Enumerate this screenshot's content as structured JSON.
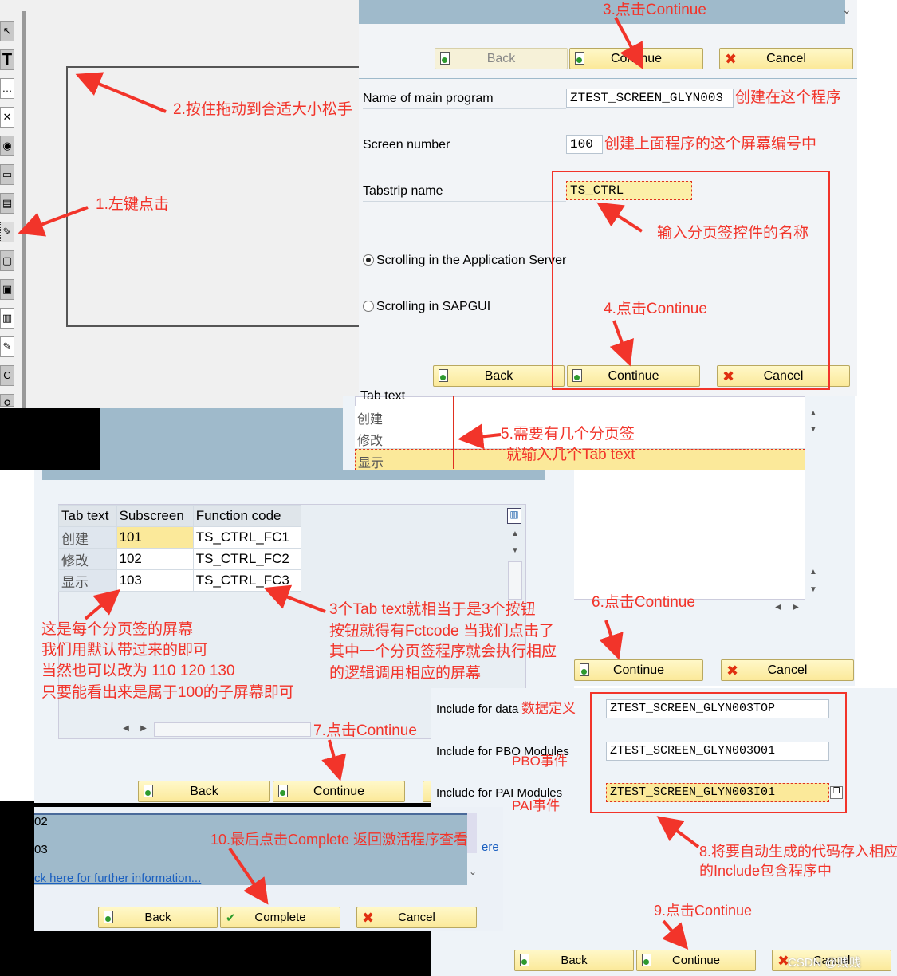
{
  "screen_painter": {
    "toolbar_icons": [
      "pointer-icon",
      "text-field-icon",
      "input-field-icon",
      "checkbox-icon",
      "radio-button-icon",
      "pushbutton-icon",
      "tabstrip-icon",
      "tabstrip-wizard-icon",
      "box-icon",
      "subscreen-icon",
      "table-control-icon",
      "table-wizard-icon",
      "custom-control-icon",
      "status-icon-icon"
    ]
  },
  "tabstrip_dialog": {
    "buttons_top": {
      "back": "Back",
      "continue": "Continue",
      "cancel": "Cancel"
    },
    "fields": [
      {
        "label": "Name of main program",
        "value": "ZTEST_SCREEN_GLYN003"
      },
      {
        "label": "Screen number",
        "value": "100"
      },
      {
        "label": "Tabstrip name",
        "value": "TS_CTRL"
      }
    ],
    "radios": [
      {
        "label": "Scrolling in the Application Server",
        "selected": true
      },
      {
        "label": "Scrolling in SAPGUI",
        "selected": false
      }
    ],
    "buttons_bottom": {
      "back": "Back",
      "continue": "Continue",
      "cancel": "Cancel"
    }
  },
  "tabtext_dialog": {
    "header": "Tab text",
    "rows": [
      "创建",
      "修改",
      "显示"
    ],
    "buttons": {
      "continue": "Continue",
      "cancel": "Cancel"
    }
  },
  "subscreen_dialog": {
    "columns": [
      "Tab text",
      "Subscreen",
      "Function code"
    ],
    "rows": [
      [
        "创建",
        "101",
        "TS_CTRL_FC1"
      ],
      [
        "修改",
        "102",
        "TS_CTRL_FC2"
      ],
      [
        "显示",
        "103",
        "TS_CTRL_FC3"
      ]
    ],
    "buttons": {
      "back": "Back",
      "continue": "Continue"
    }
  },
  "include_dialog": {
    "fields": [
      {
        "label": "Include for data",
        "value": "ZTEST_SCREEN_GLYN003TOP"
      },
      {
        "label": "Include for PBO Modules",
        "value": "ZTEST_SCREEN_GLYN003O01"
      },
      {
        "label": "Include for PAI Modules",
        "value": "ZTEST_SCREEN_GLYN003I01"
      }
    ],
    "buttons": {
      "back": "Back",
      "continue": "Continue",
      "cancel": "Cancel"
    }
  },
  "complete_dialog": {
    "lines": [
      "02",
      "03"
    ],
    "link": "ck here for further information...",
    "side_link": "ere",
    "buttons": {
      "back": "Back",
      "complete": "Complete",
      "cancel": "Cancel"
    }
  },
  "annotations": {
    "a1": "1.左键点击",
    "a2": "2.按住拖动到合适大小松手",
    "a3": "3.点击Continue",
    "a3b": "创建在这个程序",
    "a3c": "创建上面程序的这个屏幕编号中",
    "a3d": "输入分页签控件的名称",
    "a4": "4.点击Continue",
    "a5": [
      "5.需要有几个分页签",
      "就输入几个Tab text"
    ],
    "a6": "6.点击Continue",
    "sub_note": [
      "这是每个分页签的屏幕",
      "我们用默认带过来的即可",
      "当然也可以改为 110 120 130",
      "只要能看出来是属于100的子屏幕即可"
    ],
    "fc_note": [
      "3个Tab text就相当于是3个按钮",
      "按钮就得有Fctcode 当我们点击了",
      "其中一个分页签程序就会执行相应",
      "的逻辑调用相应的屏幕"
    ],
    "a7": "7.点击Continue",
    "data_def": "数据定义",
    "pbo": "PBO事件",
    "pai": "PAI事件",
    "a8": [
      "8.将要自动生成的代码存入相应",
      "的Include包含程序中"
    ],
    "a9": "9.点击Continue",
    "a10": "10.最后点击Complete 返回激活程序查看"
  },
  "watermark": "CSDN @贱贱",
  "colors": {
    "annotation": "#f2342a",
    "button": "#fbe99a",
    "header": "#9fbacb",
    "panel": "#eef3f8"
  }
}
